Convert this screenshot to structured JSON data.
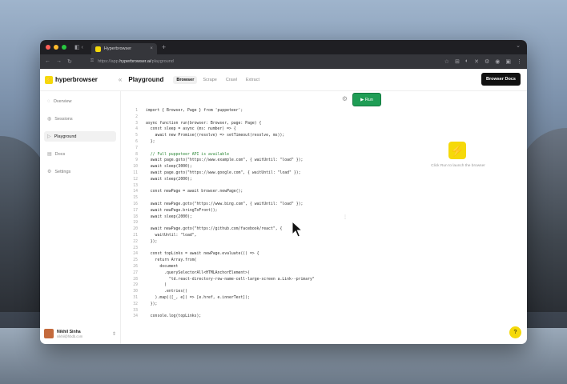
{
  "browser": {
    "tab_title": "Hyperbrowser",
    "tab_close": "×",
    "new_tab": "+",
    "tab_menu": "⌄",
    "url_prefix": "https://app.",
    "url_domain": "hyperbrowser.ai",
    "url_path": "/playground"
  },
  "app": {
    "logo_text": "hyperbrowser",
    "logo_glyph": "⚡",
    "collapse_glyph": "«",
    "page_title": "Playground",
    "tabs": [
      "Browser",
      "Scrape",
      "Crawl",
      "Extract"
    ],
    "active_tab": "Browser",
    "docs_button": "Browser Docs"
  },
  "sidebar": {
    "items": [
      {
        "label": "Overview",
        "icon": "circle-icon"
      },
      {
        "label": "Sessions",
        "icon": "globe-icon"
      },
      {
        "label": "Playground",
        "icon": "play-icon"
      },
      {
        "label": "Docs",
        "icon": "book-icon"
      },
      {
        "label": "Settings",
        "icon": "gear-icon"
      }
    ],
    "active": "Playground",
    "user_name": "Nikhil Sinha",
    "user_email": "nikhil@hbdb.com"
  },
  "editor": {
    "run_label": "▶ Run",
    "lines": [
      "import { Browser, Page } from 'puppeteer';",
      "",
      "async function run(browser: Browser, page: Page) {",
      "  const sleep = async (ms: number) => {",
      "    await new Promise((resolve) => setTimeout(resolve, ms));",
      "  };",
      "",
      "  // Full puppeteer API is available",
      "  await page.goto(\"https://www.example.com\", { waitUntil: \"load\" });",
      "  await sleep(3000);",
      "  await page.goto(\"https://www.google.com\", { waitUntil: \"load\" });",
      "  await sleep(2000);",
      "",
      "  const newPage = await browser.newPage();",
      "",
      "  await newPage.goto(\"https://www.bing.com\", { waitUntil: \"load\" });",
      "  await newPage.bringToFront();",
      "  await sleep(2000);",
      "",
      "  await newPage.goto(\"https://github.com/facebook/react\", {",
      "    waitUntil: \"load\",",
      "  });",
      "",
      "  const topLinks = await newPage.evaluate(() => {",
      "    return Array.from(",
      "      document",
      "        .querySelectorAll<HTMLAnchorElement>(",
      "          \"td.react-directory-row-name-cell-large-screen a.Link--primary\"",
      "        )",
      "        .entries()",
      "    ).map(([_, e]) => [e.href, e.innerText]);",
      "  });",
      "",
      "  console.log(topLinks);"
    ]
  },
  "preview": {
    "logo_glyph": "⚡",
    "hint": "Click Run to launch the browser",
    "help_glyph": "?"
  }
}
